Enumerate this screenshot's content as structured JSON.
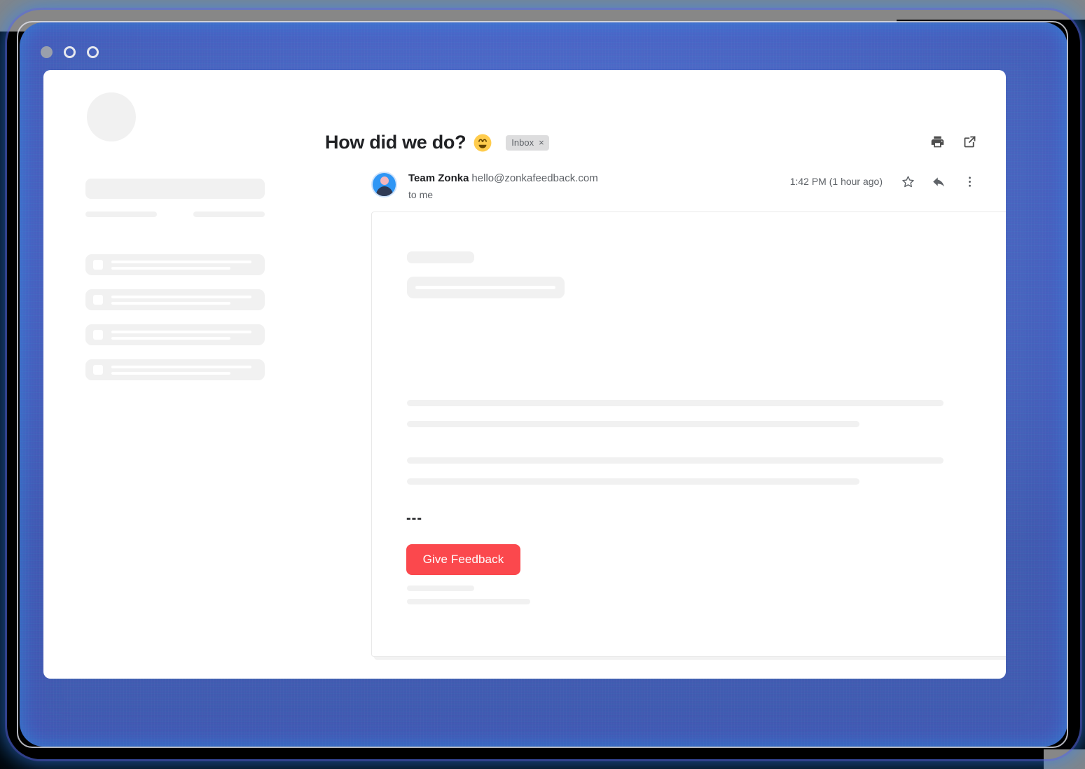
{
  "window": {
    "dots": [
      {
        "name": "close-dot",
        "style": "filled"
      },
      {
        "name": "minimize-dot",
        "style": "hollow"
      },
      {
        "name": "maximize-dot",
        "style": "hollow"
      }
    ],
    "frame_color": "#4a66c4"
  },
  "mail": {
    "subject": "How did we do?",
    "subject_emoji": "smiling-face-with-smiling-eyes",
    "label": "Inbox",
    "label_close": "×",
    "header_actions": [
      {
        "name": "print-icon",
        "label": "Print"
      },
      {
        "name": "open-in-new-window-icon",
        "label": "Open in new window"
      }
    ],
    "sender": {
      "name": "Team Zonka",
      "email": "hello@zonkafeedback.com",
      "recipient": "to me",
      "avatar": "person-avatar"
    },
    "timestamp": "1:42 PM (1 hour ago)",
    "message_actions": [
      {
        "name": "star-icon",
        "label": "Star"
      },
      {
        "name": "reply-icon",
        "label": "Reply"
      },
      {
        "name": "more-options-icon",
        "label": "More"
      }
    ],
    "body": {
      "divider": "---",
      "cta_label": "Give Feedback",
      "cta_color": "#fb484d"
    }
  },
  "sidebar": {
    "placeholder_items": [
      {
        "name": "sidebar-skeleton-item-1"
      },
      {
        "name": "sidebar-skeleton-item-2"
      },
      {
        "name": "sidebar-skeleton-item-3"
      },
      {
        "name": "sidebar-skeleton-item-4"
      }
    ]
  }
}
